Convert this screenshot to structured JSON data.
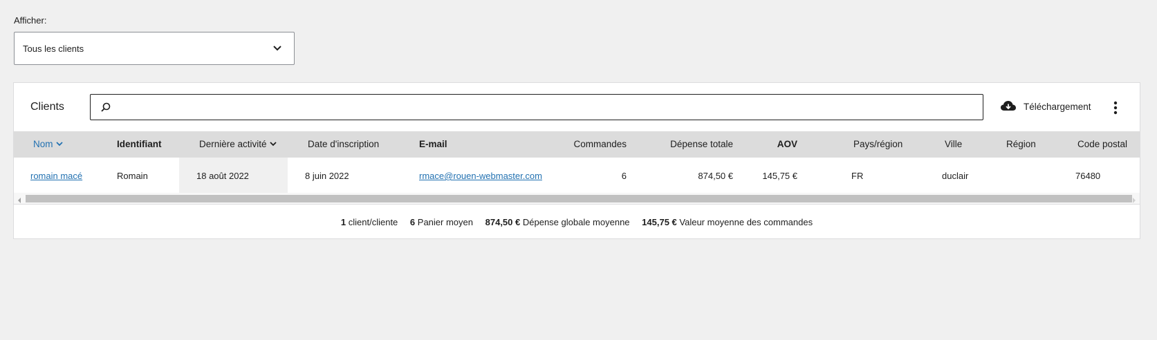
{
  "filter": {
    "label": "Afficher:",
    "selected": "Tous les clients"
  },
  "card": {
    "title": "Clients",
    "search_placeholder": "",
    "download_label": "Téléchargement"
  },
  "table": {
    "headers": {
      "name": "Nom",
      "username": "Identifiant",
      "last_active": "Dernière activité",
      "date_registered": "Date d'inscription",
      "email": "E-mail",
      "orders": "Commandes",
      "total_spend": "Dépense totale",
      "aov": "AOV",
      "country": "Pays/région",
      "city": "Ville",
      "region": "Région",
      "postcode": "Code postal"
    },
    "rows": [
      {
        "name": "romain macé",
        "username": "Romain",
        "last_active": "18 août 2022",
        "date_registered": "8 juin 2022",
        "email": "rmace@rouen-webmaster.com",
        "orders": "6",
        "total_spend": "874,50 €",
        "aov": "145,75 €",
        "country": "FR",
        "city": "duclair",
        "region": "",
        "postcode": "76480"
      }
    ]
  },
  "summary": {
    "customers_value": "1",
    "customers_label": "client/cliente",
    "avg_orders_value": "6",
    "avg_orders_label": "Panier moyen",
    "avg_spend_value": "874,50 €",
    "avg_spend_label": "Dépense globale moyenne",
    "aov_value": "145,75 €",
    "aov_label": "Valeur moyenne des commandes"
  },
  "colors": {
    "accent": "#2271b1",
    "header_bg": "#dcdcdc",
    "page_bg": "#f0f0f0"
  },
  "icons": [
    "chevron-down-icon",
    "search-icon",
    "cloud-download-icon",
    "more-vertical-icon"
  ]
}
